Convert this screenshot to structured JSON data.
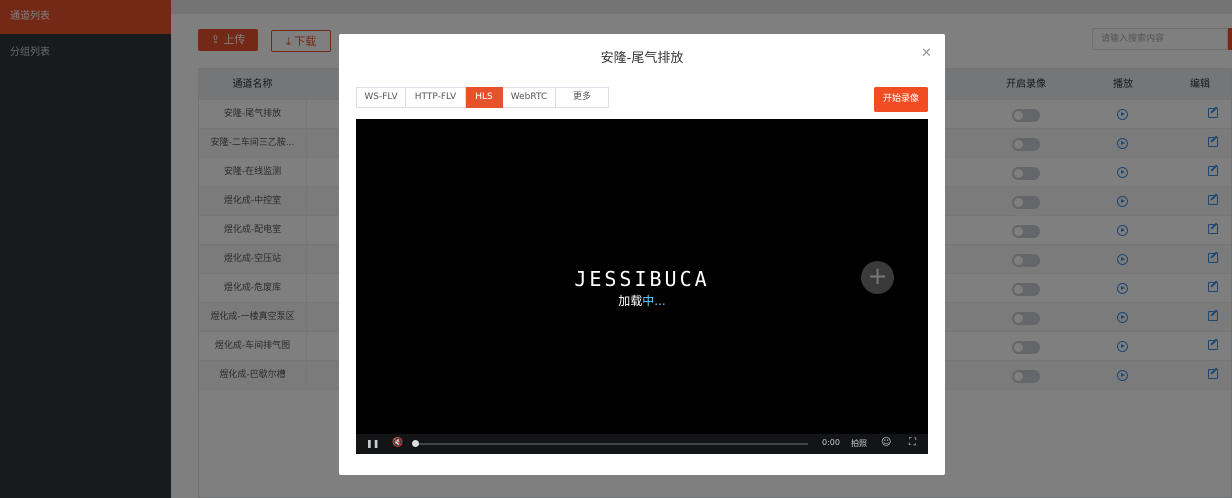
{
  "sidebar": {
    "items": [
      {
        "label": "通道列表",
        "active": true
      },
      {
        "label": "分组列表",
        "active": false
      }
    ]
  },
  "toolbar": {
    "upload_label": "上传",
    "download_label": "下载",
    "search_placeholder": "请输入搜索内容"
  },
  "table": {
    "headers": {
      "name": "通道名称",
      "record": "开启录像",
      "play": "播放",
      "edit": "编辑"
    },
    "rows": [
      {
        "name": "安隆-尾气排放",
        "recording": false
      },
      {
        "name": "安隆-二车间三乙胺...",
        "recording": false
      },
      {
        "name": "安隆-在线监测",
        "recording": false
      },
      {
        "name": "煜化成-中控室",
        "recording": false
      },
      {
        "name": "煜化成-配电室",
        "recording": false
      },
      {
        "name": "煜化成-空压站",
        "recording": false
      },
      {
        "name": "煜化成-危废库",
        "recording": false
      },
      {
        "name": "煜化成-一楼真空泵区",
        "recording": false
      },
      {
        "name": "煜化成-车间排气图",
        "recording": false
      },
      {
        "name": "煜化成-巴歇尔槽",
        "recording": false
      }
    ]
  },
  "dialog": {
    "title": "安隆-尾气排放",
    "close_icon": "close-icon",
    "tabs": [
      {
        "label": "WS-FLV",
        "active": false
      },
      {
        "label": "HTTP-FLV",
        "active": false
      },
      {
        "label": "HLS",
        "active": true
      },
      {
        "label": "WebRTC",
        "active": false
      },
      {
        "label": "更多",
        "active": false
      }
    ],
    "record_button": "开始录像",
    "player": {
      "logo": "JESSIBUCA",
      "loading_prefix": "加载",
      "loading_suffix": "中...",
      "time": "0:00",
      "screenshot_label": "拍照"
    }
  },
  "colors": {
    "accent": "#e8512c",
    "sidebar": "#30363d",
    "link": "#3a8ee6"
  }
}
